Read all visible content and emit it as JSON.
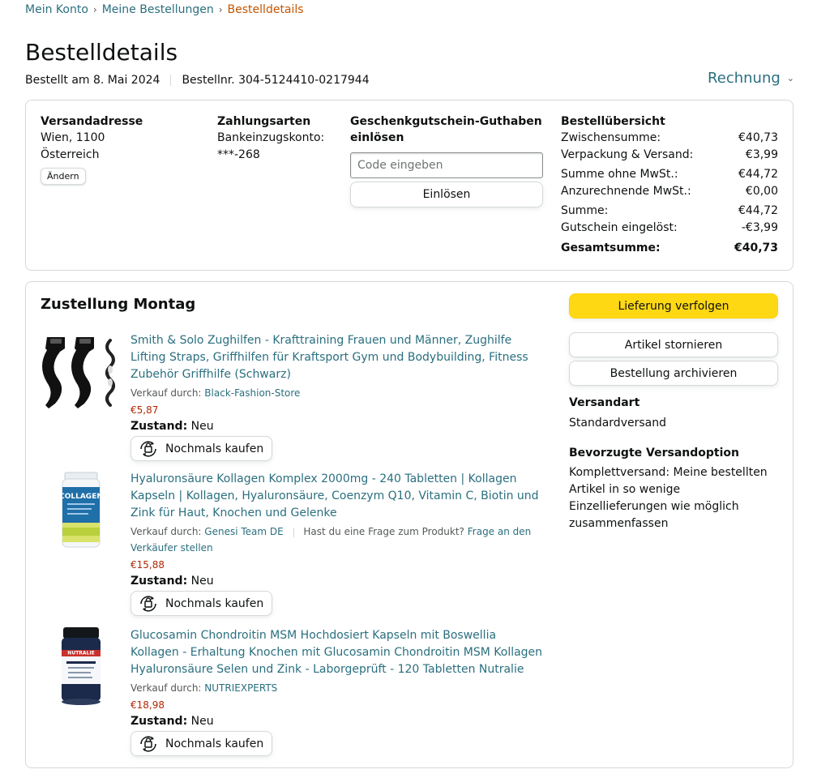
{
  "breadcrumb": {
    "items": [
      "Mein Konto",
      "Meine Bestellungen",
      "Bestelldetails"
    ],
    "separator": "›"
  },
  "page": {
    "title": "Bestelldetails",
    "ordered_on": "Bestellt am 8. Mai 2024",
    "order_number": "Bestellnr. 304-5124410-0217944",
    "invoice_label": "Rechnung",
    "invoice_icon": "chevron-down-icon"
  },
  "summary": {
    "address": {
      "title": "Versandadresse",
      "line1": "Wien, 1100",
      "line2": "Österreich",
      "change_label": "Ändern"
    },
    "payment": {
      "title": "Zahlungsarten",
      "line1": "Bankeinzugskonto:",
      "line2": "***-268"
    },
    "giftcard": {
      "title": "Geschenkgutschein-Guthaben einlösen",
      "placeholder": "Code eingeben",
      "value": "",
      "button": "Einlösen"
    },
    "overview": {
      "title": "Bestellübersicht",
      "rows": [
        {
          "label": "Zwischensumme:",
          "value": "€40,73"
        },
        {
          "label": "Verpackung & Versand:",
          "value": "€3,99"
        },
        {
          "label": "Summe ohne MwSt.:",
          "value": "€44,72"
        },
        {
          "label": "Anzurechnende MwSt.:",
          "value": "€0,00"
        },
        {
          "label": "Summe:",
          "value": "€44,72"
        },
        {
          "label": "Gutschein eingelöst:",
          "value": "-€3,99"
        }
      ],
      "total_label": "Gesamtsumme:",
      "total_value": "€40,73"
    }
  },
  "shipment": {
    "title": "Zustellung Montag",
    "items": [
      {
        "title": "Smith & Solo Zughilfen - Krafttraining Frauen und Männer, Zughilfe Lifting Straps, Griffhilfen für Kraftsport Gym und Bodybuilding, Fitness Zubehör Griffhilfe (Schwarz)",
        "seller_prefix": "Verkauf durch:",
        "seller": "Black-Fashion-Store",
        "price": "€5,87",
        "condition_label": "Zustand:",
        "condition": "Neu",
        "buy_again": "Nochmals kaufen"
      },
      {
        "title": "Hyaluronsäure Kollagen Komplex 2000mg - 240 Tabletten | Kollagen Kapseln | Kollagen, Hyaluronsäure, Coenzym Q10, Vitamin C, Biotin und Zink für Haut, Knochen und Gelenke",
        "seller_prefix": "Verkauf durch:",
        "seller": "Genesi Team DE",
        "question_prefix": "Hast du eine Frage zum Produkt?",
        "question_link": "Frage an den Verkäufer stellen",
        "price": "€15,88",
        "condition_label": "Zustand:",
        "condition": "Neu",
        "buy_again": "Nochmals kaufen",
        "image_label": "COLLAGEN"
      },
      {
        "title": "Glucosamin Chondroitin MSM Hochdosiert Kapseln mit Boswellia Kollagen - Erhaltung Knochen mit Glucosamin Chondroitin MSM Kollagen Hyaluronsäure Selen und Zink - Laborgeprüft - 120 Tabletten Nutralie",
        "seller_prefix": "Verkauf durch:",
        "seller": "NUTRIEXPERTS",
        "price": "€18,98",
        "condition_label": "Zustand:",
        "condition": "Neu",
        "buy_again": "Nochmals kaufen",
        "image_label": "NUTRALIE"
      }
    ],
    "side": {
      "track_button": "Lieferung verfolgen",
      "cancel_button": "Artikel stornieren",
      "archive_button": "Bestellung archivieren",
      "shipping_type_title": "Versandart",
      "shipping_type": "Standardversand",
      "preferred_title": "Bevorzugte Versandoption",
      "preferred_text": "Komplettversand: Meine bestellten Artikel in so wenige Einzellieferungen wie möglich zusammenfassen"
    }
  },
  "colors": {
    "link": "#2a6f7f",
    "current_crumb": "#c45500",
    "price": "#b12704",
    "primary_button": "#ffd814",
    "border": "#d5d9d9"
  }
}
